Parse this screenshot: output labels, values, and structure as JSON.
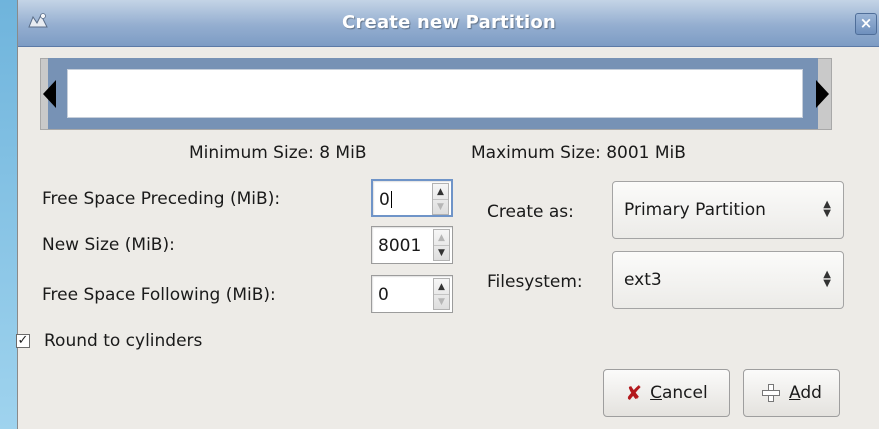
{
  "window": {
    "title": "Create new Partition",
    "close_label": "×"
  },
  "partition_bar": {
    "min_size_label": "Minimum Size: 8 MiB",
    "max_size_label": "Maximum Size: 8001 MiB"
  },
  "fields": {
    "free_preceding": {
      "label": "Free Space Preceding (MiB):",
      "value": "0"
    },
    "new_size": {
      "label": "New Size (MiB):",
      "value": "8001"
    },
    "free_following": {
      "label": "Free Space Following (MiB):",
      "value": "0"
    }
  },
  "create_as": {
    "label": "Create as:",
    "value": "Primary Partition"
  },
  "filesystem": {
    "label": "Filesystem:",
    "value": "ext3"
  },
  "round_to_cylinders": {
    "label": "Round to cylinders",
    "checked": true,
    "check_glyph": "✓"
  },
  "buttons": {
    "cancel": {
      "mnemonic": "C",
      "rest": "ancel",
      "icon": "cancel-x-icon"
    },
    "add": {
      "mnemonic": "A",
      "rest": "dd",
      "icon": "plus-icon"
    }
  },
  "colors": {
    "titlebar": "#94aed0",
    "partition_fill": "#7792b5",
    "cancel_icon": "#b3191d"
  }
}
